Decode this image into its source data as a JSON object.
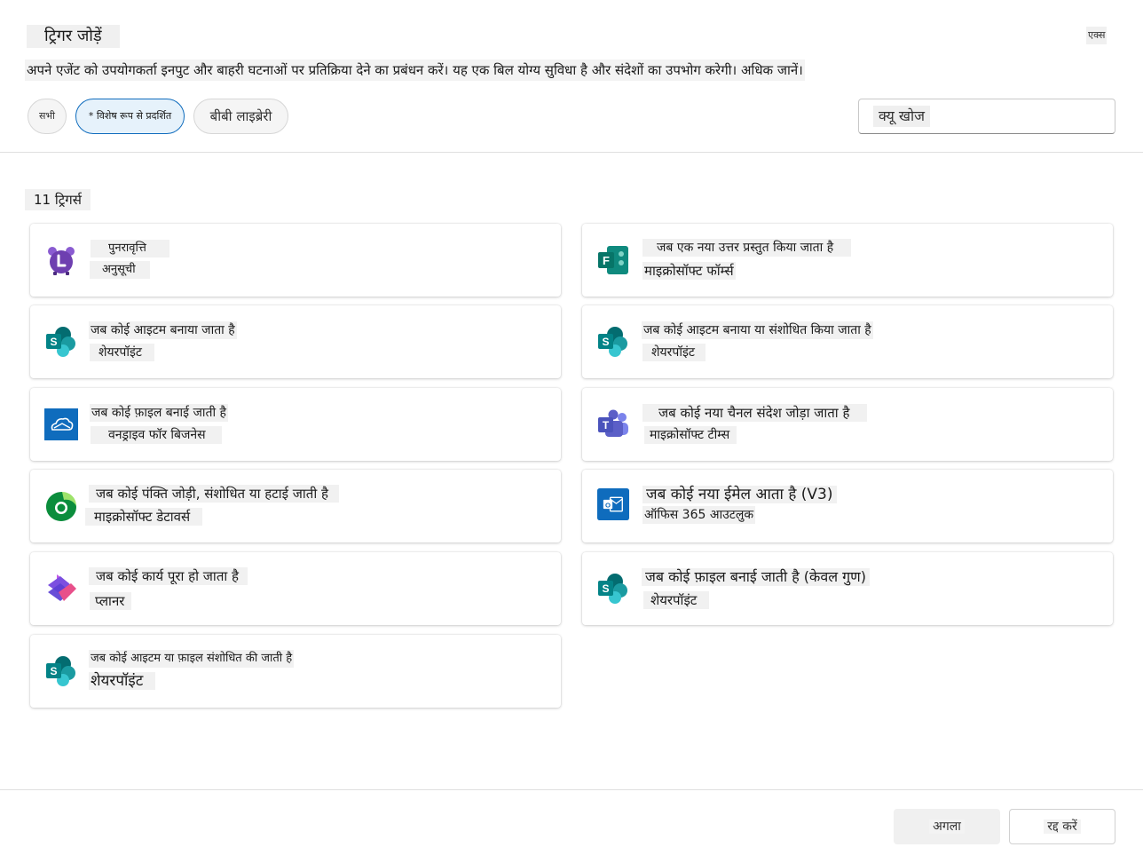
{
  "dialog": {
    "title": "ट्रिगर जोड़ें",
    "close_label": "एक्स",
    "description": "अपने एजेंट को उपयोगकर्ता इनपुट और बाहरी घटनाओं पर प्रतिक्रिया देने का प्रबंधन करें। यह एक बिल योग्य सुविधा है और संदेशों का उपभोग करेगी। अधिक जानें।"
  },
  "filters": {
    "all": "सभी",
    "featured": "* विशेष रूप से प्रदर्शित",
    "library": "बीबी लाइब्रेरी"
  },
  "search": {
    "value": "क्यू खोज"
  },
  "triggers_count": "11 ट्रिगर्स",
  "triggers": [
    {
      "title": "पुनरावृत्ति",
      "source": "अनुसूची",
      "icon": "alarm-clock-icon"
    },
    {
      "title": "जब एक नया उत्तर प्रस्तुत किया जाता है",
      "source": "माइक्रोसॉफ्ट फॉर्म्स",
      "icon": "microsoft-forms-icon"
    },
    {
      "title": "जब कोई आइटम बनाया जाता है",
      "source": "शेयरपॉइंट",
      "icon": "sharepoint-icon"
    },
    {
      "title": "जब कोई आइटम बनाया या संशोधित किया जाता है",
      "source": "शेयरपॉइंट",
      "icon": "sharepoint-icon"
    },
    {
      "title": "जब कोई फ़ाइल बनाई जाती है",
      "source": "वनड्राइव फॉर बिजनेस",
      "icon": "onedrive-icon"
    },
    {
      "title": "जब कोई नया चैनल संदेश जोड़ा जाता है",
      "source": "माइक्रोसॉफ्ट टीम्स",
      "icon": "microsoft-teams-icon"
    },
    {
      "title": "जब कोई पंक्ति जोड़ी, संशोधित या हटाई जाती है",
      "source": "माइक्रोसॉफ्ट डेटावर्स",
      "icon": "dataverse-icon"
    },
    {
      "title": "जब कोई नया ईमेल आता है (V3)",
      "source": "ऑफिस 365 आउटलुक",
      "icon": "outlook-icon"
    },
    {
      "title": "जब कोई कार्य पूरा हो जाता है",
      "source": "प्लानर",
      "icon": "planner-icon"
    },
    {
      "title": "जब कोई फ़ाइल बनाई जाती है (केवल गुण)",
      "source": "शेयरपॉइंट",
      "icon": "sharepoint-icon"
    },
    {
      "title": "जब कोई आइटम या फ़ाइल संशोधित की जाती है",
      "source": "शेयरपॉइंट",
      "icon": "sharepoint-icon"
    }
  ],
  "footer": {
    "next_label": "अगला",
    "cancel_label": "रद्द करें"
  },
  "colors": {
    "accent": "#0f6cbd",
    "featured_bg": "#e6f2fb",
    "sharepoint": "#038387",
    "forms": "#077568",
    "onedrive": "#0f6cbd",
    "teams": "#5b5fc7",
    "outlook": "#0f6cbd",
    "schedule": "#6e3fb0"
  }
}
